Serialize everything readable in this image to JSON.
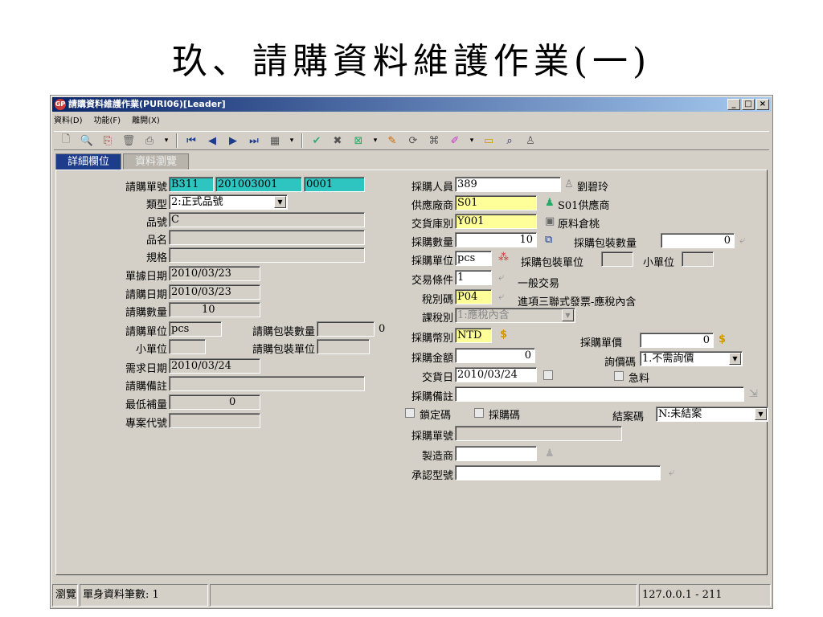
{
  "slide": {
    "title": "玖、請購資料維護作業(一)"
  },
  "window": {
    "title": "請購資料維護作業(PURI06)[Leader]",
    "app_icon": "GP"
  },
  "menu": {
    "items": [
      "資料(D)",
      "功能(F)",
      "離開(X)"
    ]
  },
  "tabs": [
    {
      "label": "詳細欄位"
    },
    {
      "label": "資料瀏覽"
    }
  ],
  "left": {
    "req_no_label": "請購單號",
    "req_no_prefix": "B311",
    "req_no_main": "201003001",
    "req_no_seq": "0001",
    "type_label": "類型",
    "type_value": "2:正式品號",
    "item_no_label": "品號",
    "item_no_value": "C",
    "item_name_label": "品名",
    "item_name_value": "",
    "spec_label": "規格",
    "spec_value": "",
    "doc_date_label": "單據日期",
    "doc_date_value": "2010/03/23",
    "req_date_label": "請購日期",
    "req_date_value": "2010/03/23",
    "req_qty_label": "請購數量",
    "req_qty_value": "10",
    "req_unit_label": "請購單位",
    "req_unit_value": "pcs",
    "pack_qty_label": "請購包裝數量",
    "pack_qty_value": "0",
    "small_unit_label": "小單位",
    "small_unit_value": "",
    "pack_unit_label": "請購包裝單位",
    "pack_unit_value": "",
    "need_date_label": "需求日期",
    "need_date_value": "2010/03/24",
    "note_label": "請購備註",
    "note_value": "",
    "min_replenish_label": "最低補量",
    "min_replenish_value": "0",
    "project_label": "專案代號",
    "project_value": ""
  },
  "right": {
    "buyer_label": "採購人員",
    "buyer_value": "389",
    "buyer_name": "劉碧玲",
    "vendor_label": "供應廠商",
    "vendor_value": "S01",
    "vendor_name": "S01供應商",
    "warehouse_label": "交貨庫別",
    "warehouse_value": "Y001",
    "warehouse_name": "原料倉桃",
    "po_qty_label": "採購數量",
    "po_qty_value": "10",
    "po_pack_qty_label": "採購包裝數量",
    "po_pack_qty_value": "0",
    "po_unit_label": "採購單位",
    "po_unit_value": "pcs",
    "po_pack_unit_label": "採購包裝單位",
    "po_pack_unit_value": "",
    "po_small_unit_label": "小單位",
    "po_small_unit_value": "",
    "terms_label": "交易條件",
    "terms_value": "1",
    "terms_name": "一般交易",
    "tax_code_label": "稅別碼",
    "tax_code_value": "P04",
    "tax_code_name": "進項三聯式發票-應稅內含",
    "tax_type_label": "課稅別",
    "tax_type_value": "1:應稅內含",
    "currency_label": "採購幣別",
    "currency_value": "NTD",
    "unit_price_label": "採購單價",
    "unit_price_value": "0",
    "amount_label": "採購金額",
    "amount_value": "0",
    "inquiry_label": "詢價碼",
    "inquiry_value": "1.不需詢價",
    "delivery_label": "交貨日",
    "delivery_value": "2010/03/24",
    "urgent_label": "急料",
    "po_note_label": "採購備註",
    "po_note_value": "",
    "lock_label": "鎖定碼",
    "po_code_label": "採購碼",
    "close_label": "結案碼",
    "close_value": "N:未結案",
    "po_no_label": "採購單號",
    "po_no_value": "",
    "maker_label": "製造商",
    "maker_value": "",
    "approved_model_label": "承認型號",
    "approved_model_value": ""
  },
  "status": {
    "mode": "瀏覽",
    "records": "單身資料筆數: 1",
    "server": "127.0.0.1 - 211"
  }
}
